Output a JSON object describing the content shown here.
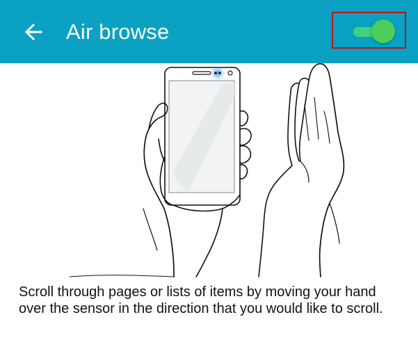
{
  "header": {
    "title": "Air browse",
    "back_icon": "arrow-left-icon",
    "background_color": "#0aa1c2"
  },
  "toggle": {
    "state": "on",
    "track_color": "#3fd27a",
    "thumb_color": "#4cce5c",
    "highlight_color": "#b8141c"
  },
  "illustration": {
    "icon": "hand-holding-phone-with-palm-gesture"
  },
  "description": "Scroll through pages or lists of items by moving your hand over the sensor in the direction that you would like to scroll."
}
